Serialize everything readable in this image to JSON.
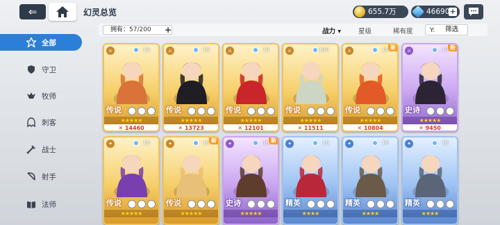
{
  "topbar": {
    "title": "幻灵总览",
    "gold": "655.7万",
    "gems": "46690",
    "plus": "+"
  },
  "sidebar": {
    "items": [
      {
        "label": "全部",
        "icon": "all-icon",
        "active": true
      },
      {
        "label": "守卫",
        "icon": "shield-icon",
        "active": false
      },
      {
        "label": "牧师",
        "icon": "priest-icon",
        "active": false
      },
      {
        "label": "刺客",
        "icon": "assassin-icon",
        "active": false
      },
      {
        "label": "战士",
        "icon": "sword-icon",
        "active": false
      },
      {
        "label": "射手",
        "icon": "bow-icon",
        "active": false
      },
      {
        "label": "法师",
        "icon": "book-icon",
        "active": false
      }
    ]
  },
  "filterbar": {
    "owned": "拥有：57/200",
    "owned_plus": "+",
    "sort_power": "战力 ▾",
    "sort_star": "星级",
    "sort_rarity": "稀有度",
    "filter": "筛选",
    "filter_icon": "Y:"
  },
  "cards": [
    {
      "rarity": "传说",
      "tier": "gold",
      "level": "10",
      "stars": "★★★★★",
      "power": "✕ 14460",
      "new": "",
      "class_badge": "⚔",
      "portrait_color": "#d9733a"
    },
    {
      "rarity": "传说",
      "tier": "gold",
      "level": "10",
      "stars": "★★★★★",
      "power": "✕ 13723",
      "new": "",
      "class_badge": "⚔",
      "portrait_color": "#1e1e24"
    },
    {
      "rarity": "传说",
      "tier": "gold",
      "level": "10",
      "stars": "★★★★★",
      "power": "✕ 12101",
      "new": "",
      "class_badge": "⚔",
      "portrait_color": "#c8262a"
    },
    {
      "rarity": "传说",
      "tier": "gold",
      "level": "100",
      "stars": "★★★★★",
      "power": "✕ 11511",
      "new": "",
      "class_badge": "⚔",
      "portrait_color": "#cdd6c4"
    },
    {
      "rarity": "传说",
      "tier": "gold",
      "level": "10",
      "stars": "★★★★★",
      "power": "✕ 10804",
      "new": "新",
      "class_badge": "⚔",
      "portrait_color": "#e25a28"
    },
    {
      "rarity": "史诗",
      "tier": "purple",
      "level": "10",
      "stars": "★★★★★",
      "power": "✕ 9450",
      "new": "新",
      "class_badge": "⚔",
      "portrait_color": "#2c2434"
    },
    {
      "rarity": "传说",
      "tier": "gold",
      "level": "16",
      "stars": "★★★★★",
      "power": "",
      "new": "",
      "class_badge": "✦",
      "portrait_color": "#7a3fae"
    },
    {
      "rarity": "传说",
      "tier": "gold",
      "level": "16",
      "stars": "★★★★★",
      "power": "",
      "new": "新",
      "class_badge": "✦",
      "portrait_color": "#e8c078"
    },
    {
      "rarity": "史诗",
      "tier": "purple",
      "level": "16",
      "stars": "★★★★★",
      "power": "",
      "new": "新",
      "class_badge": "✦",
      "portrait_color": "#5e3d2e"
    },
    {
      "rarity": "精英",
      "tier": "blue",
      "level": "16",
      "stars": "★★★★",
      "power": "",
      "new": "",
      "class_badge": "✦",
      "portrait_color": "#b8283a"
    },
    {
      "rarity": "精英",
      "tier": "blue",
      "level": "16",
      "stars": "★★★★",
      "power": "",
      "new": "",
      "class_badge": "✦",
      "portrait_color": "#6a5a4a"
    },
    {
      "rarity": "精英",
      "tier": "blue",
      "level": "16",
      "stars": "★★★★",
      "power": "",
      "new": "",
      "class_badge": "✦",
      "portrait_color": "#5c6478"
    }
  ]
}
